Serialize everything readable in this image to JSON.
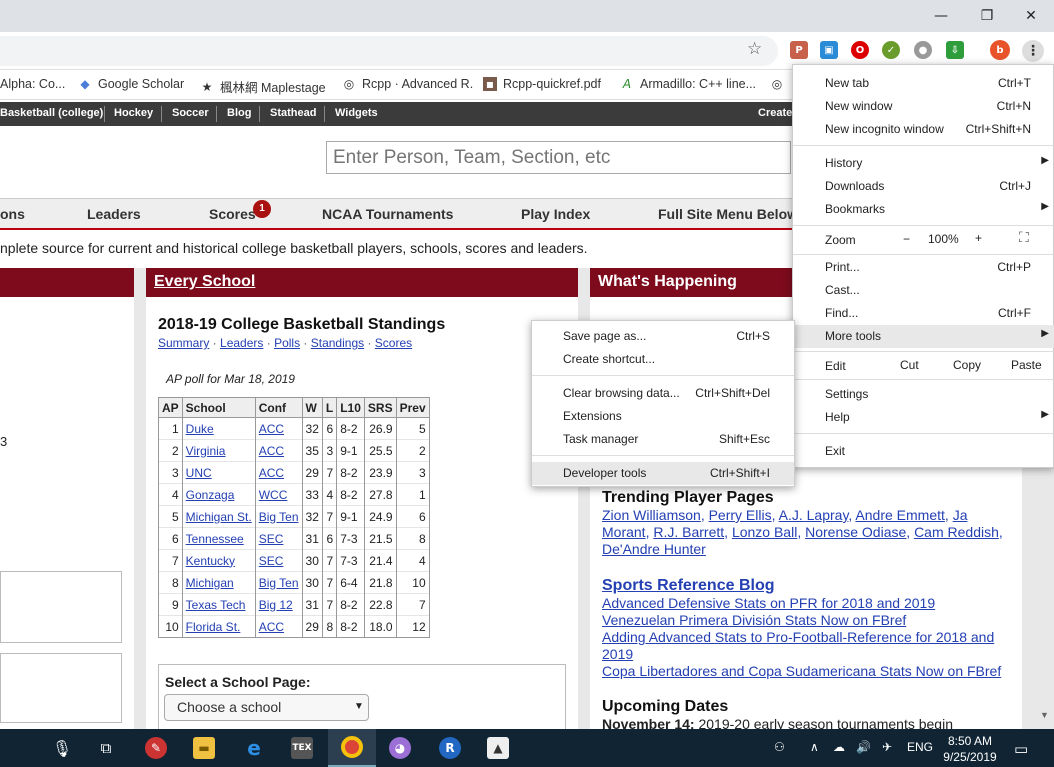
{
  "window": {
    "minimize": "—",
    "restore": "❐",
    "close": "✕"
  },
  "omnibox": {
    "star": "☆",
    "profile_initial": "b",
    "menu": "⋮"
  },
  "bookmarks": [
    {
      "icon": "alpha-icon",
      "label": "Alpha: Co..."
    },
    {
      "icon": "scholar-icon",
      "label": "Google Scholar"
    },
    {
      "icon": "maple-icon",
      "label": "楓林網 Maplestage"
    },
    {
      "icon": "globe-icon",
      "label": "Rcpp · Advanced R."
    },
    {
      "icon": "pdf-icon",
      "label": "Rcpp-quickref.pdf"
    },
    {
      "icon": "armadillo-icon",
      "label": "Armadillo: C++ line..."
    },
    {
      "icon": "globe-icon",
      "label": ""
    }
  ],
  "sitenav": [
    "Basketball (college)",
    "Hockey",
    "Soccer",
    "Blog",
    "Stathead",
    "Widgets",
    "Create"
  ],
  "search": {
    "placeholder": "Enter Person, Team, Section, etc"
  },
  "mainnav": [
    "ons",
    "Leaders",
    "Scores",
    "NCAA Tournaments",
    "Play Index",
    "Full Site Menu Below"
  ],
  "scores_badge": "1",
  "tagline": "nplete source for current and historical college basketball players, schools, scores and leaders.",
  "panels": {
    "every_school": "Every School",
    "whats_happening": "What's Happening"
  },
  "standings": {
    "title": "2018-19 College Basketball Standings",
    "links": [
      "Summary",
      "Leaders",
      "Polls",
      "Standings",
      "Scores"
    ],
    "poll_caption": "AP poll for Mar 18, 2019",
    "columns": [
      "AP",
      "School",
      "Conf",
      "W",
      "L",
      "L10",
      "SRS",
      "Prev"
    ],
    "rows": [
      [
        "1",
        "Duke",
        "ACC",
        "32",
        "6",
        "8-2",
        "26.9",
        "5"
      ],
      [
        "2",
        "Virginia",
        "ACC",
        "35",
        "3",
        "9-1",
        "25.5",
        "2"
      ],
      [
        "3",
        "UNC",
        "ACC",
        "29",
        "7",
        "8-2",
        "23.9",
        "3"
      ],
      [
        "4",
        "Gonzaga",
        "WCC",
        "33",
        "4",
        "8-2",
        "27.8",
        "1"
      ],
      [
        "5",
        "Michigan St.",
        "Big Ten",
        "32",
        "7",
        "9-1",
        "24.9",
        "6"
      ],
      [
        "6",
        "Tennessee",
        "SEC",
        "31",
        "6",
        "7-3",
        "21.5",
        "8"
      ],
      [
        "7",
        "Kentucky",
        "SEC",
        "30",
        "7",
        "7-3",
        "21.4",
        "4"
      ],
      [
        "8",
        "Michigan",
        "Big Ten",
        "30",
        "7",
        "6-4",
        "21.8",
        "10"
      ],
      [
        "9",
        "Texas Tech",
        "Big 12",
        "31",
        "7",
        "8-2",
        "22.8",
        "7"
      ],
      [
        "10",
        "Florida St.",
        "ACC",
        "29",
        "8",
        "8-2",
        "18.0",
        "12"
      ]
    ]
  },
  "select_school": {
    "label": "Select a School Page:",
    "value": "Choose a school"
  },
  "left_fragment": "3",
  "trending": {
    "heading": "Trending Player Pages",
    "line1": [
      "Zion Williamson",
      "Perry Ellis",
      "A.J. Lapray",
      "Andre Emmett",
      "Ja"
    ],
    "line2": [
      "Morant",
      "R.J. Barrett",
      "Lonzo Ball",
      "Norense Odiase",
      "Cam Reddish"
    ],
    "line3": [
      "De'Andre Hunter"
    ]
  },
  "blog": {
    "heading": "Sports Reference Blog",
    "posts": [
      "Advanced Defensive Stats on PFR for 2018 and 2019",
      "Venezuelan Primera División Stats Now on FBref",
      "Adding Advanced Stats to Pro-Football-Reference for 2018 and",
      "2019",
      "Copa Libertadores and Copa Sudamericana Stats Now on FBref"
    ]
  },
  "upcoming": {
    "heading": "Upcoming Dates",
    "date": "November 14:",
    "text": "2019-20 early season tournaments begin"
  },
  "chrome_menu": {
    "new_tab": {
      "label": "New tab",
      "shortcut": "Ctrl+T"
    },
    "new_window": {
      "label": "New window",
      "shortcut": "Ctrl+N"
    },
    "incognito": {
      "label": "New incognito window",
      "shortcut": "Ctrl+Shift+N"
    },
    "history": {
      "label": "History"
    },
    "downloads": {
      "label": "Downloads",
      "shortcut": "Ctrl+J"
    },
    "bookmarks": {
      "label": "Bookmarks"
    },
    "zoom": {
      "label": "Zoom",
      "minus": "−",
      "value": "100%",
      "plus": "+"
    },
    "print": {
      "label": "Print...",
      "shortcut": "Ctrl+P"
    },
    "cast": {
      "label": "Cast..."
    },
    "find": {
      "label": "Find...",
      "shortcut": "Ctrl+F"
    },
    "more_tools": {
      "label": "More tools"
    },
    "edit": {
      "label": "Edit",
      "cut": "Cut",
      "copy": "Copy",
      "paste": "Paste"
    },
    "settings": {
      "label": "Settings"
    },
    "help": {
      "label": "Help"
    },
    "exit": {
      "label": "Exit"
    }
  },
  "more_tools_menu": {
    "save_page": {
      "label": "Save page as...",
      "shortcut": "Ctrl+S"
    },
    "create_shortcut": {
      "label": "Create shortcut..."
    },
    "clear_data": {
      "label": "Clear browsing data...",
      "shortcut": "Ctrl+Shift+Del"
    },
    "extensions": {
      "label": "Extensions"
    },
    "task_manager": {
      "label": "Task manager",
      "shortcut": "Shift+Esc"
    },
    "dev_tools": {
      "label": "Developer tools",
      "shortcut": "Ctrl+Shift+I"
    }
  },
  "taskbar": {
    "lang": "ENG",
    "time": "8:50 AM",
    "date": "9/25/2019"
  },
  "colors": {
    "brand_red": "#7d0b1c",
    "link": "#2440b3",
    "taskbar": "#102433"
  }
}
